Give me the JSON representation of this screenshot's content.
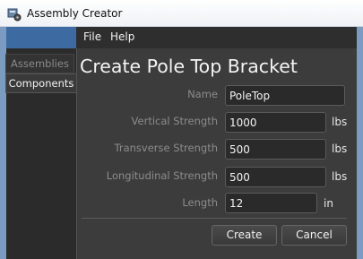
{
  "window": {
    "title": "Assembly Creator",
    "icon": "assembly-app-icon"
  },
  "menu": {
    "items": [
      "File",
      "Help"
    ]
  },
  "sidebar": {
    "tabs": [
      {
        "label": "Assemblies",
        "selected": false
      },
      {
        "label": "Components",
        "selected": true
      }
    ]
  },
  "form": {
    "heading": "Create Pole Top Bracket",
    "fields": [
      {
        "label": "Name",
        "value": "PoleTop",
        "unit": ""
      },
      {
        "label": "Vertical Strength",
        "value": "1000",
        "unit": "lbs"
      },
      {
        "label": "Transverse Strength",
        "value": "500",
        "unit": "lbs"
      },
      {
        "label": "Longitudinal Strength",
        "value": "500",
        "unit": "lbs"
      },
      {
        "label": "Length",
        "value": "12",
        "unit": "in"
      }
    ]
  },
  "buttons": {
    "create": "Create",
    "cancel": "Cancel"
  },
  "colors": {
    "background": "#3c3c3c",
    "accent": "#3d6aa0",
    "frame": "#7b9bc0"
  }
}
